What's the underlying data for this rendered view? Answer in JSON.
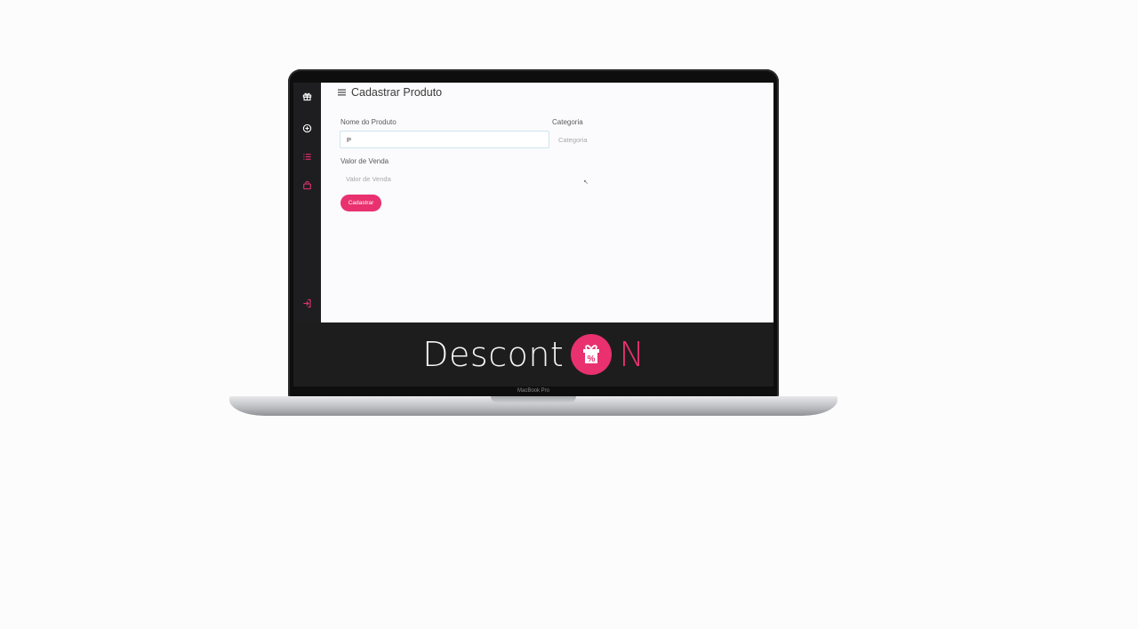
{
  "device": {
    "bezel_label": "MacBook Pro"
  },
  "sidebar": {
    "items": [
      {
        "name": "gift-icon",
        "color": "#ffffff"
      },
      {
        "name": "plus-circle-icon",
        "color": "#ffffff"
      },
      {
        "name": "list-icon",
        "color": "#e8316e"
      },
      {
        "name": "bag-icon",
        "color": "#e8316e"
      }
    ],
    "logout": {
      "name": "logout-icon",
      "color": "#e8316e"
    }
  },
  "header": {
    "menu_icon": "hamburger-icon",
    "title": "Cadastrar Produto"
  },
  "form": {
    "product_name": {
      "label": "Nome do Produto",
      "value": "P"
    },
    "category": {
      "label": "Categoria",
      "placeholder": "Categoria"
    },
    "sale_value": {
      "label": "Valor de Venda",
      "placeholder": "Valor de Venda"
    },
    "submit_label": "Cadastrar"
  },
  "brand": {
    "text": "Descont",
    "suffix": "N",
    "badge_symbol": "%",
    "accent_color": "#e8316e"
  }
}
